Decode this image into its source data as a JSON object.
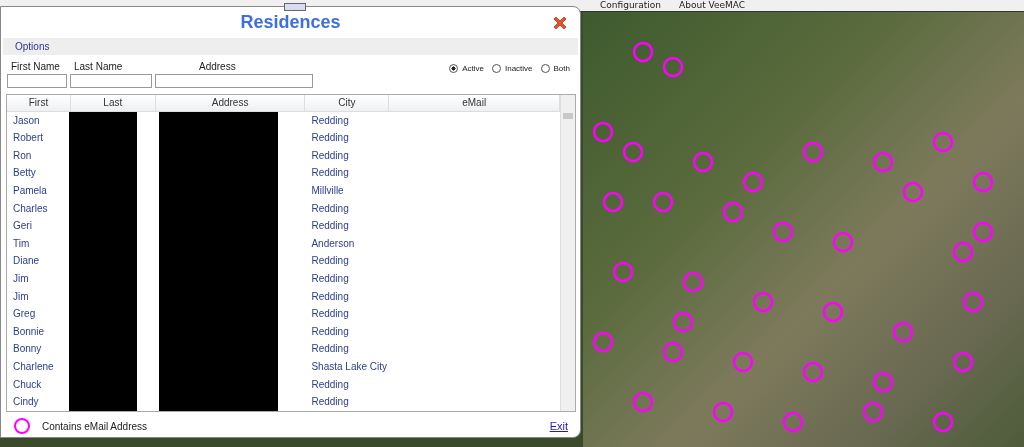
{
  "menu_bar": {
    "items": [
      "Configuration",
      "About VeeMAC"
    ]
  },
  "dialog": {
    "title": "Residences",
    "options_label": "Options",
    "fields": [
      {
        "label": "First Name"
      },
      {
        "label": "Last Name"
      },
      {
        "label": "Address"
      }
    ],
    "status_filter": [
      {
        "label": "Active",
        "selected": true
      },
      {
        "label": "Inactive",
        "selected": false
      },
      {
        "label": "Both",
        "selected": false
      }
    ],
    "table": {
      "columns": [
        "First",
        "Last",
        "Address",
        "City",
        "eMail"
      ],
      "rows": [
        {
          "first": "Jason",
          "city": "Redding"
        },
        {
          "first": "Robert",
          "city": "Redding"
        },
        {
          "first": "Ron",
          "city": "Redding"
        },
        {
          "first": "Betty",
          "city": "Redding"
        },
        {
          "first": "Pamela",
          "city": "Millville"
        },
        {
          "first": "Charles",
          "city": "Redding"
        },
        {
          "first": "Geri",
          "city": "Redding"
        },
        {
          "first": "Tim",
          "city": "Anderson"
        },
        {
          "first": "Diane",
          "city": "Redding"
        },
        {
          "first": "Jim",
          "city": "Redding"
        },
        {
          "first": "Jim",
          "city": "Redding"
        },
        {
          "first": "Greg",
          "city": "Redding"
        },
        {
          "first": "Bonnie",
          "city": "Redding"
        },
        {
          "first": "Bonny",
          "city": "Redding"
        },
        {
          "first": "Charlene",
          "city": "Shasta Lake City"
        },
        {
          "first": "Chuck",
          "city": "Redding"
        },
        {
          "first": "Cindy",
          "city": "Redding"
        }
      ]
    },
    "legend": "Contains eMail Address",
    "exit": "Exit"
  }
}
